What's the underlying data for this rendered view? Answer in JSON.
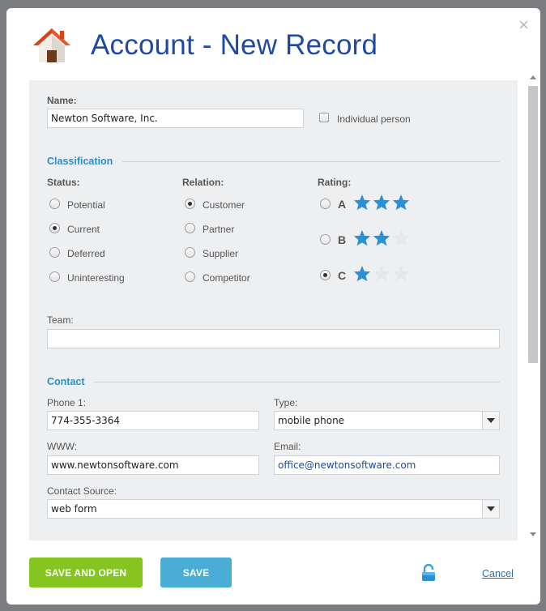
{
  "dialog": {
    "title": "Account - New Record",
    "close_glyph": "×"
  },
  "form": {
    "name": {
      "label": "Name:",
      "value": "Newton Software, Inc."
    },
    "individual_person": {
      "label": "Individual person",
      "checked": false
    },
    "classification": {
      "title": "Classification",
      "status": {
        "label": "Status:",
        "options": [
          "Potential",
          "Current",
          "Deferred",
          "Uninteresting"
        ],
        "selected": "Current"
      },
      "relation": {
        "label": "Relation:",
        "options": [
          "Customer",
          "Partner",
          "Supplier",
          "Competitor"
        ],
        "selected": "Customer"
      },
      "rating": {
        "label": "Rating:",
        "options": [
          {
            "letter": "A",
            "stars": 3
          },
          {
            "letter": "B",
            "stars": 2
          },
          {
            "letter": "C",
            "stars": 1
          }
        ],
        "selected": "C",
        "max_stars": 3
      }
    },
    "team": {
      "label": "Team:",
      "value": ""
    },
    "contact": {
      "title": "Contact",
      "phone1": {
        "label": "Phone 1:",
        "value": "774-355-3364"
      },
      "type": {
        "label": "Type:",
        "value": "mobile phone"
      },
      "www": {
        "label": "WWW:",
        "value": "www.newtonsoftware.com"
      },
      "email": {
        "label": "Email:",
        "value": "office@newtonsoftware.com"
      },
      "contact_source": {
        "label": "Contact Source:",
        "value": "web form"
      }
    }
  },
  "footer": {
    "save_and_open": "SAVE AND OPEN",
    "save": "SAVE",
    "lock_icon": "unlocked-padlock-icon",
    "cancel": "Cancel"
  },
  "colors": {
    "title": "#1f4aa0",
    "section": "#2c8fc6",
    "star_on": "#2b8fd4",
    "star_off": "#e6e7e9",
    "save_open_button": "#86c51f",
    "save_button": "#49add6",
    "cancel_link": "#2270b8"
  }
}
